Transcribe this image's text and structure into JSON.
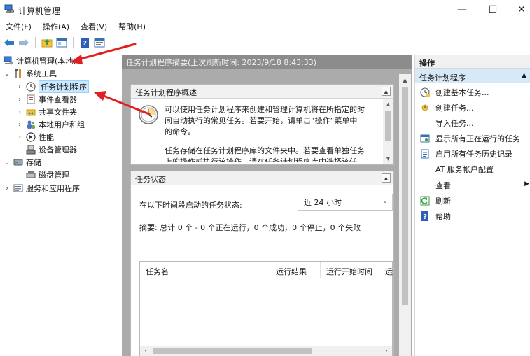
{
  "window": {
    "title": "计算机管理",
    "minimize_glyph": "—",
    "maximize_glyph": "☐",
    "close_glyph": "✕"
  },
  "menu": [
    "文件(F)",
    "操作(A)",
    "查看(V)",
    "帮助(H)"
  ],
  "toolbar": [
    "back-icon",
    "forward-icon",
    "up-folder-icon",
    "show-hide-tree-icon",
    "help-icon",
    "properties-icon"
  ],
  "tree": {
    "root": "计算机管理(本地)",
    "system_tools": "系统工具",
    "task_scheduler": "任务计划程序",
    "event_viewer": "事件查看器",
    "shared_folders": "共享文件夹",
    "local_users": "本地用户和组",
    "performance": "性能",
    "device_manager": "设备管理器",
    "storage": "存储",
    "disk_management": "磁盘管理",
    "services_apps": "服务和应用程序"
  },
  "center": {
    "header": "任务计划程序摘要(上次刷新时间: 2023/9/18 8:43:33)",
    "overview_title": "任务计划程序概述",
    "overview_p1_line1": "可以使用任务计划程序来创建和管理计算机将在所指定的时",
    "overview_p1_line2": "间自动执行的常见任务。若要开始，请单击“操作”菜单中",
    "overview_p1_line3": "的命令。",
    "overview_p2_line1": "任务存储在任务计划程序库的文件夹中。若要查看单独任务",
    "overview_p2_line2": "上的操作或执行该操作，请在任务计划程序库中选择该任",
    "status_title": "任务状态",
    "status_label": "在以下时间段启动的任务状态:",
    "status_period": "近 24 小时",
    "summary": "摘要: 总计 0 个 - 0 个正在运行，0 个成功，0 个停止，0 个失败",
    "table_headers": [
      "任务名",
      "运行结果",
      "运行开始时间",
      "运"
    ]
  },
  "actions": {
    "header": "操作",
    "section": "任务计划程序",
    "items": [
      {
        "label": "创建基本任务...",
        "icon": "create-basic-task-icon"
      },
      {
        "label": "创建任务...",
        "icon": "create-task-icon"
      },
      {
        "label": "导入任务...",
        "icon": ""
      },
      {
        "label": "显示所有正在运行的任务",
        "icon": "running-tasks-icon"
      },
      {
        "label": "启用所有任务历史记录",
        "icon": "history-icon"
      },
      {
        "label": "AT 服务帐户配置",
        "icon": ""
      },
      {
        "label": "查看",
        "icon": ""
      },
      {
        "label": "刷新",
        "icon": "refresh-icon"
      },
      {
        "label": "帮助",
        "icon": "help-icon"
      }
    ]
  },
  "colors": {
    "selection": "#cce8ff",
    "annotation_arrow": "#e02020",
    "center_bg": "#ababab",
    "actions_section_bg": "#d6e9f8"
  }
}
